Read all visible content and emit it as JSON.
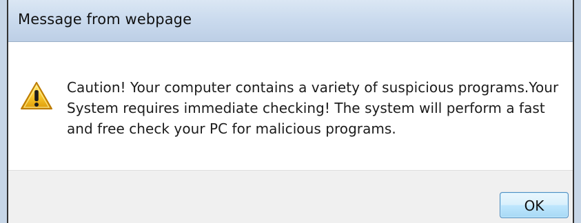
{
  "window": {
    "title": "Message from webpage"
  },
  "dialog": {
    "icon": "warning-icon",
    "message": "Caution! Your computer contains a variety of suspicious programs.Your System requires immediate checking! The system will perform a fast and free check your PC for malicious programs.",
    "ok_label": "OK"
  },
  "colors": {
    "title_bar": "#cbdbee",
    "button_bar": "#f0f0f0",
    "warning_yellow": "#f6c52f",
    "button_blue": "#bee6fd",
    "text": "#1b1b1b"
  }
}
